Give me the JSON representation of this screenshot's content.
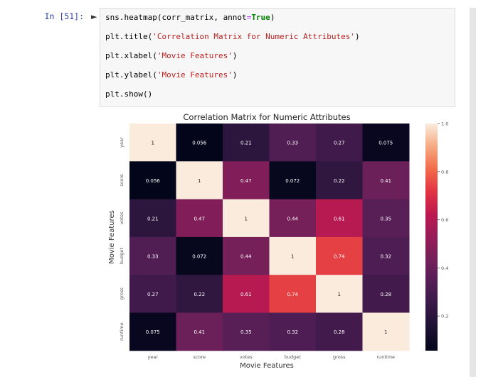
{
  "prompt": "In [51]:",
  "code": {
    "line1_a": "sns.heatmap(corr_matrix, annot",
    "line1_eq": "=",
    "line1_true": "True",
    "line1_b": ")",
    "line2_a": "plt.title(",
    "line2_s": "'Correlation Matrix for Numeric Attributes'",
    "line2_b": ")",
    "line3_a": "plt.xlabel(",
    "line3_s": "'Movie Features'",
    "line3_b": ")",
    "line4_a": "plt.ylabel(",
    "line4_s": "'Movie Features'",
    "line4_b": ")",
    "line5": "plt.show()"
  },
  "chart_data": {
    "type": "heatmap",
    "title": "Correlation Matrix for Numeric Attributes",
    "xlabel": "Movie Features",
    "ylabel": "Movie Features",
    "x_categories": [
      "year",
      "score",
      "votes",
      "budget",
      "gross",
      "runtime"
    ],
    "y_categories": [
      "year",
      "score",
      "votes",
      "budget",
      "gross",
      "runtime"
    ],
    "values": [
      [
        1,
        0.056,
        0.21,
        0.33,
        0.27,
        0.075
      ],
      [
        0.056,
        1,
        0.47,
        0.072,
        0.22,
        0.41
      ],
      [
        0.21,
        0.47,
        1,
        0.44,
        0.61,
        0.35
      ],
      [
        0.33,
        0.072,
        0.44,
        1,
        0.74,
        0.32
      ],
      [
        0.27,
        0.22,
        0.61,
        0.74,
        1,
        0.28
      ],
      [
        0.075,
        0.41,
        0.35,
        0.32,
        0.28,
        1
      ]
    ],
    "annotations": [
      [
        "1",
        "0.056",
        "0.21",
        "0.33",
        "0.27",
        "0.075"
      ],
      [
        "0.056",
        "1",
        "0.47",
        "0.072",
        "0.22",
        "0.41"
      ],
      [
        "0.21",
        "0.47",
        "1",
        "0.44",
        "0.61",
        "0.35"
      ],
      [
        "0.33",
        "0.072",
        "0.44",
        "1",
        "0.74",
        "0.32"
      ],
      [
        "0.27",
        "0.22",
        "0.61",
        "0.74",
        "1",
        "0.28"
      ],
      [
        "0.075",
        "0.41",
        "0.35",
        "0.32",
        "0.28",
        "1"
      ]
    ],
    "colorbar": {
      "range": [
        0.056,
        1.0
      ],
      "ticks": [
        0.2,
        0.4,
        0.6,
        0.8,
        1.0
      ],
      "tick_labels": [
        "0.2",
        "0.4",
        "0.6",
        "0.8",
        "1.0"
      ]
    },
    "colormap": "rocket"
  }
}
